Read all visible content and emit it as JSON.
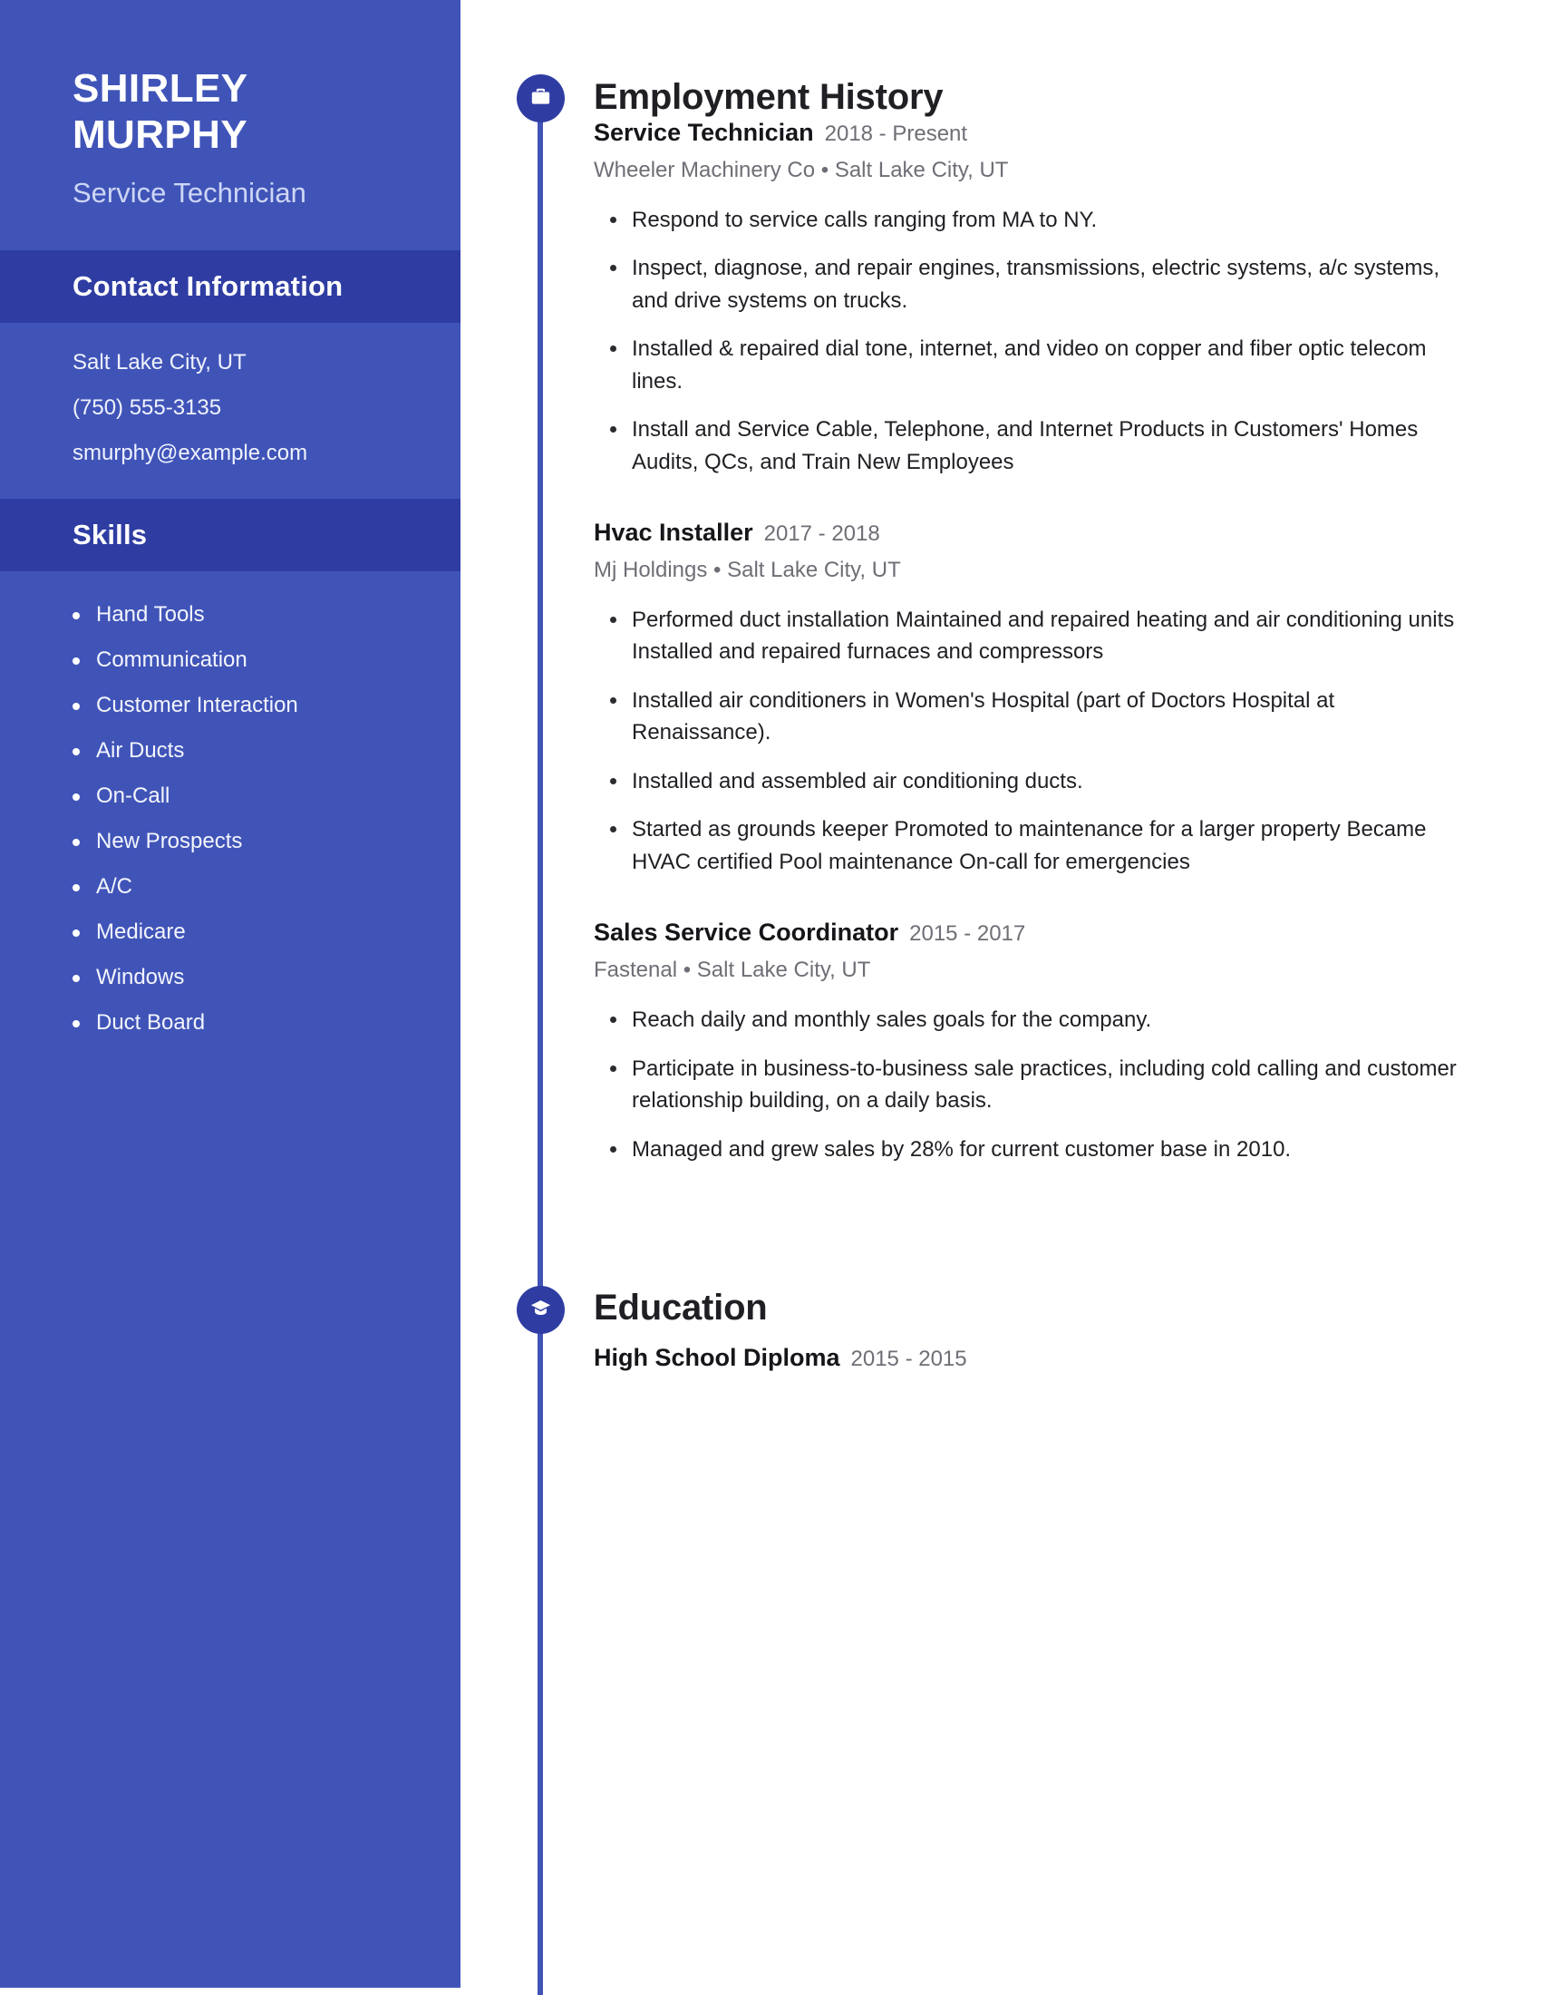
{
  "theme": {
    "sidebar_bg": "#4054b8",
    "band_bg": "#2f3da3",
    "accent": "#2f3da3",
    "text_dark": "#1f1f24",
    "text_muted": "#6e6e76"
  },
  "sidebar": {
    "name_first": "SHIRLEY",
    "name_last": "MURPHY",
    "job_title": "Service Technician",
    "contact_heading": "Contact Information",
    "contact": [
      "Salt Lake City, UT",
      "(750) 555-3135",
      "smurphy@example.com"
    ],
    "skills_heading": "Skills",
    "skills": [
      "Hand Tools",
      "Communication",
      "Customer Interaction",
      "Air Ducts",
      "On-Call",
      "New Prospects",
      "A/C",
      "Medicare",
      "Windows",
      "Duct Board"
    ]
  },
  "main": {
    "employment": {
      "heading": "Employment History",
      "icon": "briefcase-icon",
      "entries": [
        {
          "role": "Service Technician",
          "dates": "2018 - Present",
          "meta": "Wheeler Machinery Co • Salt Lake City, UT",
          "bullets": [
            "Respond to service calls ranging from MA to NY.",
            "Inspect, diagnose, and repair engines, transmissions, electric systems, a/c systems, and drive systems on trucks.",
            "Installed & repaired dial tone, internet, and video on copper and fiber optic telecom lines.",
            "Install and Service Cable, Telephone, and Internet Products in Customers' Homes Audits, QCs, and Train New Employees"
          ]
        },
        {
          "role": "Hvac Installer",
          "dates": "2017 - 2018",
          "meta": "Mj Holdings • Salt Lake City, UT",
          "bullets": [
            "Performed duct installation Maintained and repaired heating and air conditioning units Installed and repaired furnaces and compressors",
            "Installed air conditioners in Women's Hospital (part of Doctors Hospital at Renaissance).",
            "Installed and assembled air conditioning ducts.",
            "Started as grounds keeper Promoted to maintenance for a larger property Became HVAC certified Pool maintenance On-call for emergencies"
          ]
        },
        {
          "role": "Sales Service Coordinator",
          "dates": "2015 - 2017",
          "meta": "Fastenal • Salt Lake City, UT",
          "bullets": [
            "Reach daily and monthly sales goals for the company.",
            "Participate in business-to-business sale practices, including cold calling and customer relationship building, on a daily basis.",
            "Managed and grew sales by 28% for current customer base in 2010."
          ]
        }
      ]
    },
    "education": {
      "heading": "Education",
      "icon": "graduation-cap-icon",
      "entries": [
        {
          "degree": "High School Diploma",
          "dates": "2015 - 2015"
        }
      ]
    }
  }
}
